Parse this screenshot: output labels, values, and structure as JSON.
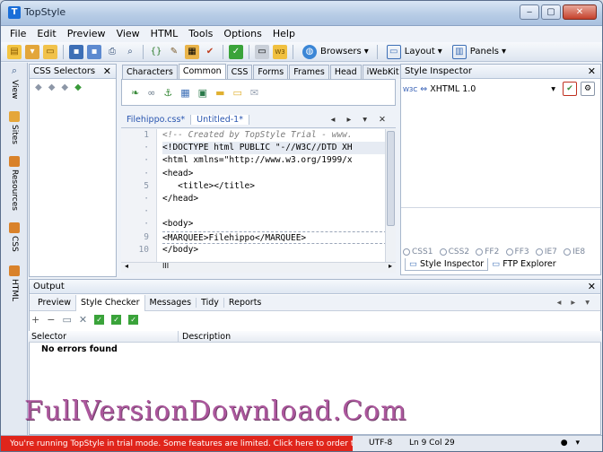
{
  "app": {
    "title": "TopStyle"
  },
  "window_buttons": {
    "minimize": "‒",
    "maximize": "▢",
    "close": "✕"
  },
  "menu": [
    "File",
    "Edit",
    "Preview",
    "View",
    "HTML",
    "Tools",
    "Options",
    "Help"
  ],
  "toolbar": {
    "browsers_label": "Browsers",
    "layout_label": "Layout",
    "panels_label": "Panels"
  },
  "side_tabs": [
    "View",
    "Sites",
    "Resources",
    "CSS",
    "HTML"
  ],
  "css_selectors": {
    "title": "CSS Selectors"
  },
  "editor": {
    "insert_tabs": [
      "Characters",
      "Common",
      "CSS",
      "Forms",
      "Frames",
      "Head",
      "iWebKit"
    ],
    "active_insert_tab": "Common",
    "doc_tabs": [
      "Filehippo.css*",
      "Untitled-1*"
    ],
    "line_numbers": [
      "1",
      "·",
      "·",
      "·",
      "5",
      "·",
      "·",
      "·",
      "9",
      "10"
    ],
    "lines": [
      "<!-- Created by TopStyle Trial - www.",
      "<!DOCTYPE html PUBLIC \"-//W3C//DTD XH",
      "<html xmlns=\"http://www.w3.org/1999/x",
      "<head>",
      "   <title></title>",
      "</head>",
      "",
      "<body>",
      "<MARQUEE>Filehippo</MARQUEE>",
      "</body>"
    ],
    "h_scroll_label": "III"
  },
  "style_inspector": {
    "title": "Style Inspector",
    "doctype": "XHTML 1.0",
    "doctype_prefix": "W3C",
    "browsers": [
      "CSS1",
      "CSS2",
      "FF2",
      "FF3",
      "IE7",
      "IE8"
    ],
    "bottom_tabs": [
      "Style Inspector",
      "FTP Explorer"
    ]
  },
  "output": {
    "title": "Output",
    "tabs": [
      "Preview",
      "Style Checker",
      "Messages",
      "Tidy",
      "Reports"
    ],
    "active_tab": "Style Checker",
    "columns": [
      "Selector",
      "Description"
    ],
    "message": "No errors found"
  },
  "status": {
    "trial_text": "You're running TopStyle in trial mode. Some features are limited. Click here to order the registered version.",
    "encoding": "UTF-8",
    "position": "Ln 9 Col 29"
  },
  "watermark": "FullVersionDownload.Com",
  "colors": {
    "trial_bg": "#e0251b",
    "accent": "#1a6ed8"
  }
}
